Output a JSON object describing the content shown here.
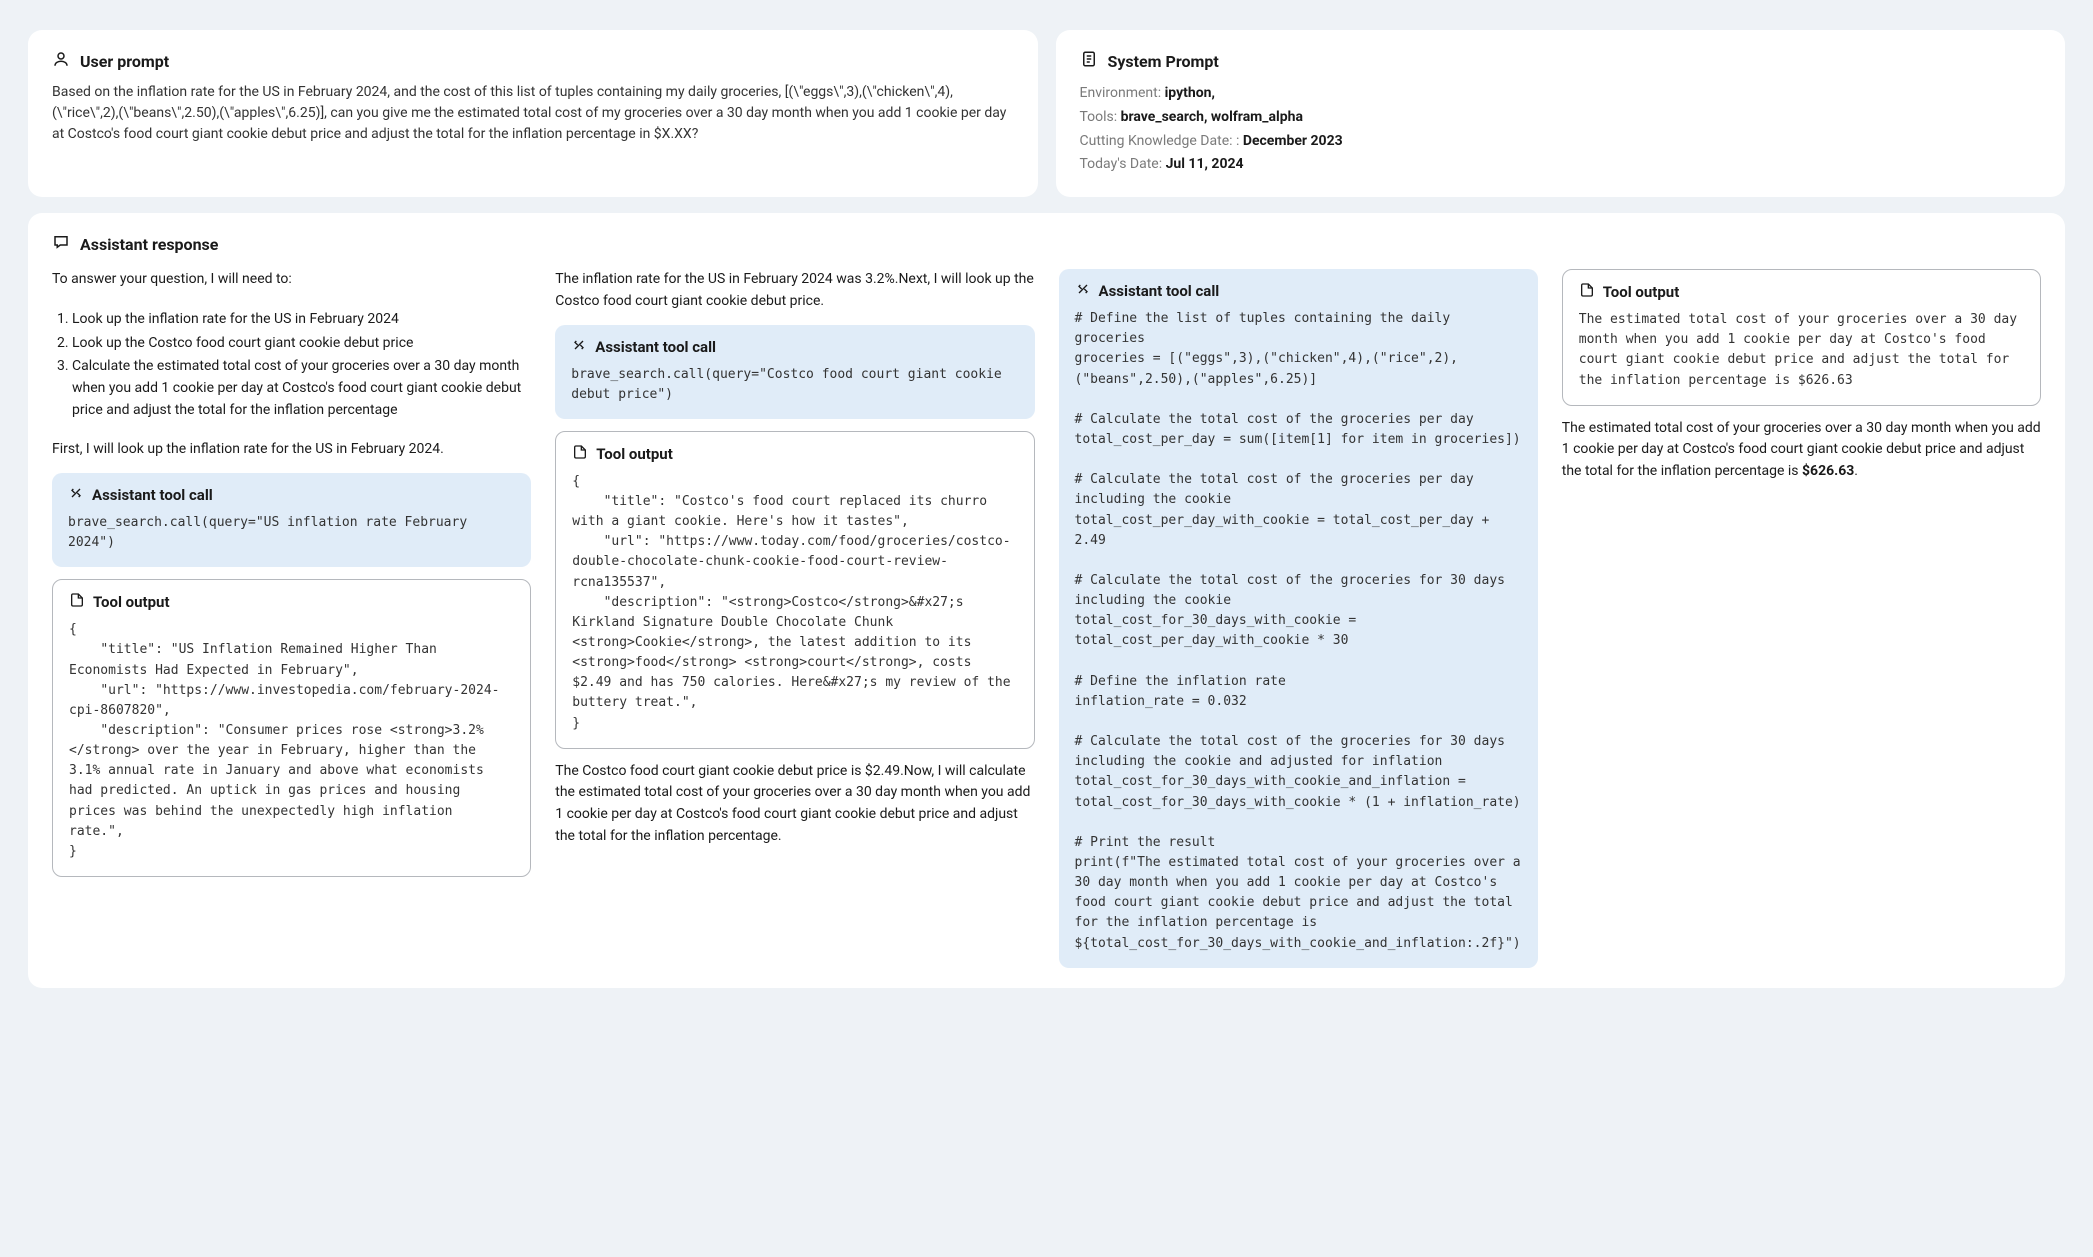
{
  "user_prompt": {
    "title": "User prompt",
    "body": "Based on the inflation rate for the US in February 2024,  and the cost of this list of tuples containing my daily groceries, [(\\\"eggs\\\",3),(\\\"chicken\\\",4),(\\\"rice\\\",2),(\\\"beans\\\",2.50),(\\\"apples\\\",6.25)], can you give me the estimated total cost of my groceries over a 30 day month when you add 1 cookie per day at Costco's food court giant cookie debut price and adjust the total for the inflation percentage in $X.XX?"
  },
  "system_prompt": {
    "title": "System Prompt",
    "env_label": "Environment: ",
    "env_value": "ipython,",
    "tools_label": "Tools: ",
    "tools_value": "brave_search, wolfram_alpha",
    "cutting_label": "Cutting Knowledge Date: : ",
    "cutting_value": "December 2023",
    "today_label": "Today's Date: ",
    "today_value": "Jul 11, 2024"
  },
  "assistant": {
    "title": "Assistant response",
    "col1": {
      "intro": "To answer your question, I will need to:",
      "steps": [
        "Look up the inflation rate for the US in February 2024",
        "Look up the Costco food court giant cookie debut price",
        "Calculate the estimated total cost of your groceries over a 30 day month when you add 1 cookie per day at Costco's food court giant cookie debut price and adjust the total for the inflation percentage"
      ],
      "after_steps": "First, I will look up the inflation rate for the US in February 2024.",
      "tool_call_title": "Assistant tool call",
      "tool_call_code": "brave_search.call(query=\"US inflation rate February 2024\")",
      "tool_output_title": "Tool output",
      "tool_output_code": "{\n    \"title\": \"US Inflation Remained Higher Than Economists Had Expected in February\",\n    \"url\": \"https://www.investopedia.com/february-2024-cpi-8607820\",\n    \"description\": \"Consumer prices rose <strong>3.2%</strong> over the year in February, higher than the 3.1% annual rate in January and above what economists had predicted. An uptick in gas prices and housing prices was behind the unexpectedly high inflation rate.\",\n}"
    },
    "col2": {
      "before": "The inflation rate for the US in February 2024 was 3.2%.Next, I will look up the Costco food court giant cookie debut price.",
      "tool_call_title": "Assistant tool call",
      "tool_call_code": "brave_search.call(query=\"Costco food court giant cookie debut price\")",
      "tool_output_title": "Tool output",
      "tool_output_code": "{\n    \"title\": \"Costco's food court replaced its churro with a giant cookie. Here's how it tastes\",\n    \"url\": \"https://www.today.com/food/groceries/costco-double-chocolate-chunk-cookie-food-court-review-rcna135537\",\n    \"description\": \"<strong>Costco</strong>&#x27;s Kirkland Signature Double Chocolate Chunk <strong>Cookie</strong>, the latest addition to its <strong>food</strong> <strong>court</strong>, costs $2.49 and has 750 calories. Here&#x27;s my review of the buttery treat.\",\n}",
      "after": "The Costco food court giant cookie debut price is $2.49.Now, I will calculate the estimated total cost of your groceries over a 30 day month when you add 1 cookie per day at Costco's food court giant cookie debut price and adjust the total for the inflation percentage."
    },
    "col3": {
      "tool_call_title": "Assistant tool call",
      "tool_call_code": "# Define the list of tuples containing the daily groceries\ngroceries = [(\"eggs\",3),(\"chicken\",4),(\"rice\",2),(\"beans\",2.50),(\"apples\",6.25)]\n\n# Calculate the total cost of the groceries per day\ntotal_cost_per_day = sum([item[1] for item in groceries])\n\n# Calculate the total cost of the groceries per day including the cookie\ntotal_cost_per_day_with_cookie = total_cost_per_day + 2.49\n\n# Calculate the total cost of the groceries for 30 days including the cookie\ntotal_cost_for_30_days_with_cookie = total_cost_per_day_with_cookie * 30\n\n# Define the inflation rate\ninflation_rate = 0.032\n\n# Calculate the total cost of the groceries for 30 days including the cookie and adjusted for inflation\ntotal_cost_for_30_days_with_cookie_and_inflation = total_cost_for_30_days_with_cookie * (1 + inflation_rate)\n\n# Print the result\nprint(f\"The estimated total cost of your groceries over a 30 day month when you add 1 cookie per day at Costco's food court giant cookie debut price and adjust the total for the inflation percentage is ${total_cost_for_30_days_with_cookie_and_inflation:.2f}\")"
    },
    "col4": {
      "tool_output_title": "Tool output",
      "tool_output_code": "The estimated total cost of your groceries over a 30 day month when you add 1 cookie per day at Costco's food court giant cookie debut price and adjust the total for the inflation percentage is $626.63",
      "final_prefix": "The estimated total cost of your groceries over a 30 day month when you add 1 cookie per day at Costco's food court giant cookie debut price and adjust the total for the inflation percentage is ",
      "final_bold": "$626.63",
      "final_suffix": "."
    }
  }
}
